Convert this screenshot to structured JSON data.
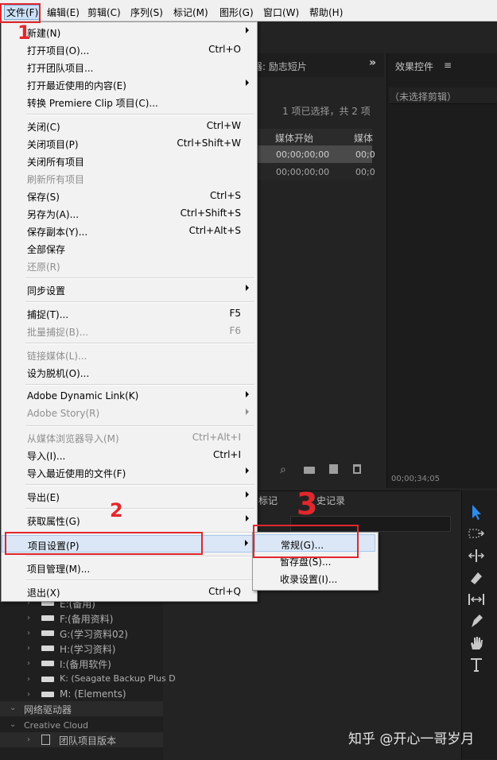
{
  "menubar": {
    "items": [
      "文件(F)",
      "编辑(E)",
      "剪辑(C)",
      "序列(S)",
      "标记(M)",
      "图形(G)",
      "窗口(W)",
      "帮助(H)"
    ]
  },
  "project_panel": {
    "tab_label": "器: 励志短片",
    "selection_status": "1 项已选择，共 2 项",
    "col_media_start": "媒体开始",
    "col_media_cut": "媒体",
    "rows": [
      {
        "start": "00;00;00;00",
        "cut": "00;0"
      },
      {
        "start": "00;00;00;00",
        "cut": "00;0"
      }
    ]
  },
  "effects_panel": {
    "title": "效果控件",
    "menu_icon": "≡",
    "no_clip": "（未选择剪辑）",
    "timecode": "00;00;34;05"
  },
  "lower_tabs": {
    "history_partial": "标记",
    "history_label": "史记录"
  },
  "file_menu": {
    "items": [
      {
        "label": "新建(N)",
        "shortcut": "",
        "submenu": true,
        "disabled": false
      },
      {
        "label": "打开项目(O)...",
        "shortcut": "Ctrl+O",
        "submenu": false,
        "disabled": false
      },
      {
        "label": "打开团队项目...",
        "shortcut": "",
        "submenu": false,
        "disabled": false
      },
      {
        "label": "打开最近使用的内容(E)",
        "shortcut": "",
        "submenu": true,
        "disabled": false
      },
      {
        "label": "转换 Premiere Clip 项目(C)...",
        "shortcut": "",
        "submenu": false,
        "disabled": false
      },
      {
        "label": "关闭(C)",
        "shortcut": "Ctrl+W",
        "submenu": false,
        "disabled": false
      },
      {
        "label": "关闭项目(P)",
        "shortcut": "Ctrl+Shift+W",
        "submenu": false,
        "disabled": false
      },
      {
        "label": "关闭所有项目",
        "shortcut": "",
        "submenu": false,
        "disabled": false
      },
      {
        "label": "刷新所有项目",
        "shortcut": "",
        "submenu": false,
        "disabled": true
      },
      {
        "label": "保存(S)",
        "shortcut": "Ctrl+S",
        "submenu": false,
        "disabled": false
      },
      {
        "label": "另存为(A)...",
        "shortcut": "Ctrl+Shift+S",
        "submenu": false,
        "disabled": false
      },
      {
        "label": "保存副本(Y)...",
        "shortcut": "Ctrl+Alt+S",
        "submenu": false,
        "disabled": false
      },
      {
        "label": "全部保存",
        "shortcut": "",
        "submenu": false,
        "disabled": false
      },
      {
        "label": "还原(R)",
        "shortcut": "",
        "submenu": false,
        "disabled": true
      },
      {
        "label": "同步设置",
        "shortcut": "",
        "submenu": true,
        "disabled": false
      },
      {
        "label": "捕捉(T)...",
        "shortcut": "F5",
        "submenu": false,
        "disabled": false
      },
      {
        "label": "批量捕捉(B)...",
        "shortcut": "F6",
        "submenu": false,
        "disabled": true
      },
      {
        "label": "链接媒体(L)...",
        "shortcut": "",
        "submenu": false,
        "disabled": true
      },
      {
        "label": "设为脱机(O)...",
        "shortcut": "",
        "submenu": false,
        "disabled": false
      },
      {
        "label": "Adobe Dynamic Link(K)",
        "shortcut": "",
        "submenu": true,
        "disabled": false
      },
      {
        "label": "Adobe Story(R)",
        "shortcut": "",
        "submenu": true,
        "disabled": true
      },
      {
        "label": "从媒体浏览器导入(M)",
        "shortcut": "Ctrl+Alt+I",
        "submenu": false,
        "disabled": true
      },
      {
        "label": "导入(I)...",
        "shortcut": "Ctrl+I",
        "submenu": false,
        "disabled": false
      },
      {
        "label": "导入最近使用的文件(F)",
        "shortcut": "",
        "submenu": true,
        "disabled": false
      },
      {
        "label": "导出(E)",
        "shortcut": "",
        "submenu": true,
        "disabled": false
      },
      {
        "label": "获取属性(G)",
        "shortcut": "",
        "submenu": true,
        "disabled": false
      },
      {
        "label": "项目设置(P)",
        "shortcut": "",
        "submenu": true,
        "disabled": false,
        "highlighted": true
      },
      {
        "label": "项目管理(M)...",
        "shortcut": "",
        "submenu": false,
        "disabled": false
      },
      {
        "label": "退出(X)",
        "shortcut": "Ctrl+Q",
        "submenu": false,
        "disabled": false
      }
    ]
  },
  "project_settings_submenu": {
    "items": [
      {
        "label": "常规(G)...",
        "highlighted": true
      },
      {
        "label": "暂存盘(S)..."
      },
      {
        "label": "收录设置(I)..."
      }
    ]
  },
  "annotations": {
    "step1": "1",
    "step2": "2",
    "step3": "3",
    "accent": "#e1272c"
  },
  "media_browser": {
    "drives": [
      "E:(备用)",
      "F:(备用资料)",
      "G:(学习资料02)",
      "H:(学习资料)",
      "I:(备用软件)",
      "K: (Seagate Backup Plus D",
      "M: (Elements)"
    ],
    "network": "网络驱动器",
    "creative_cloud": "Creative Cloud",
    "team_versions": "团队项目版本"
  },
  "watermark": "知乎 @开心一哥岁月",
  "tools": [
    "selection-tool-icon",
    "track-select-icon",
    "ripple-edit-icon",
    "razor-icon",
    "slip-icon",
    "pen-icon",
    "hand-icon",
    "type-icon"
  ]
}
